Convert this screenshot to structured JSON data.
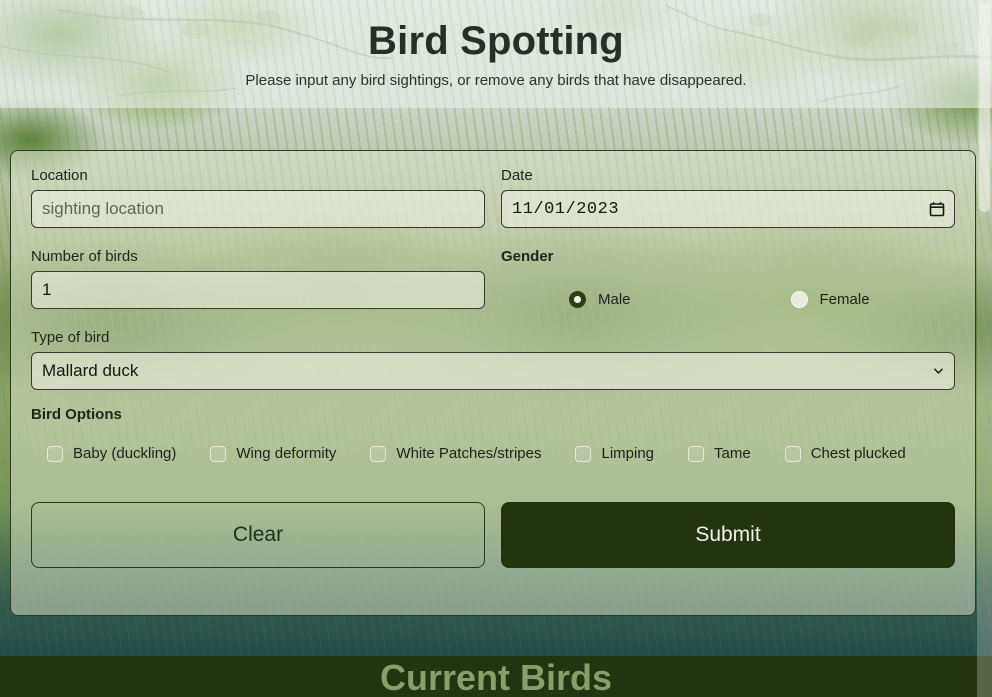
{
  "header": {
    "title": "Bird Spotting",
    "subtitle": "Please input any bird sightings, or remove any birds that have disappeared."
  },
  "form": {
    "location": {
      "label": "Location",
      "placeholder": "sighting location",
      "value": ""
    },
    "date": {
      "label": "Date",
      "value": "11/01/2023",
      "icon": "calendar-icon"
    },
    "number_of_birds": {
      "label": "Number of birds",
      "value": "1"
    },
    "gender": {
      "label": "Gender",
      "options": [
        {
          "label": "Male",
          "selected": true
        },
        {
          "label": "Female",
          "selected": false
        }
      ]
    },
    "type_of_bird": {
      "label": "Type of bird",
      "value": "Mallard duck",
      "icon": "chevron-down-icon"
    },
    "bird_options": {
      "label": "Bird Options",
      "items": [
        {
          "label": "Baby (duckling)",
          "checked": false
        },
        {
          "label": "Wing deformity",
          "checked": false
        },
        {
          "label": "White Patches/stripes",
          "checked": false
        },
        {
          "label": "Limping",
          "checked": false
        },
        {
          "label": "Tame",
          "checked": false
        },
        {
          "label": "Chest plucked",
          "checked": false
        }
      ]
    },
    "buttons": {
      "clear": "Clear",
      "submit": "Submit"
    }
  },
  "bottom": {
    "title": "Current Birds"
  },
  "colors": {
    "submit_bg": "#24340f",
    "bottom_band_bg": "#243310",
    "bottom_title": "#8a9e6a",
    "radio_selected": "#2e3d17",
    "card_border": "#2e3a22"
  }
}
